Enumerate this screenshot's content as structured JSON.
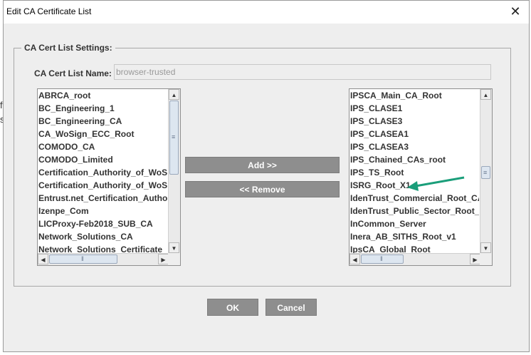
{
  "background": {
    "left_chars": [
      "f",
      "s"
    ]
  },
  "window": {
    "title": "Edit CA Certificate List",
    "close_icon": "close-icon"
  },
  "settings": {
    "legend": "CA Cert List Settings:",
    "name_label": "CA Cert List Name:",
    "name_value": "browser-trusted"
  },
  "available_list": {
    "items": [
      "ABRCA_root",
      "BC_Engineering_1",
      "BC_Engineering_CA",
      "CA_WoSign_ECC_Root",
      "COMODO_CA",
      "COMODO_Limited",
      "Certification_Authority_of_WoSign",
      "Certification_Authority_of_WoSign",
      "Entrust.net_Certification_Authority",
      "Izenpe_Com",
      "LICProxy-Feb2018_SUB_CA",
      "Network_Solutions_CA",
      "Network_Solutions_Certificate"
    ]
  },
  "selected_list": {
    "items": [
      "IPSCA_Main_CA_Root",
      "IPS_CLASE1",
      "IPS_CLASE3",
      "IPS_CLASEA1",
      "IPS_CLASEA3",
      "IPS_Chained_CAs_root",
      "IPS_TS_Root",
      "ISRG_Root_X1",
      "IdenTrust_Commercial_Root_CA",
      "IdenTrust_Public_Sector_Root_CA",
      "InCommon_Server",
      "Inera_AB_SITHS_Root_v1",
      "IpsCA_Global_Root"
    ]
  },
  "actions": {
    "add_label": "Add >>",
    "remove_label": "<< Remove"
  },
  "footer": {
    "ok_label": "OK",
    "cancel_label": "Cancel"
  },
  "colors": {
    "annotation_arrow": "#1a9e7a"
  }
}
